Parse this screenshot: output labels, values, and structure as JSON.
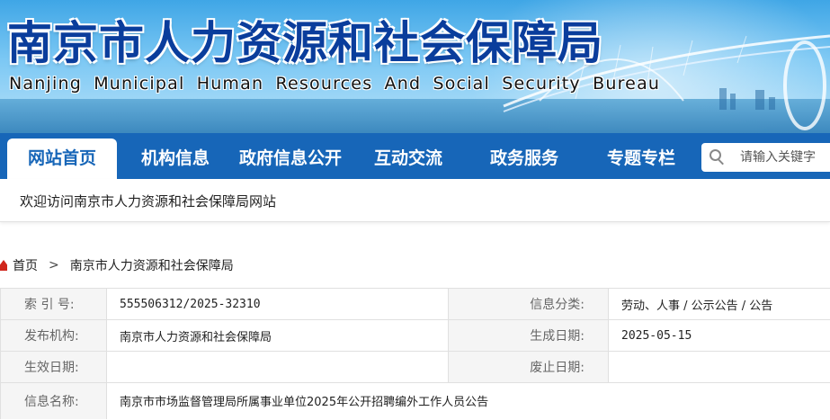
{
  "header": {
    "title_cn": "南京市人力资源和社会保障局",
    "title_en": "Nanjing Municipal Human Resources And Social Security Bureau"
  },
  "nav": {
    "items": [
      {
        "label": "网站首页",
        "active": true
      },
      {
        "label": "机构信息"
      },
      {
        "label": "政府信息公开"
      },
      {
        "label": "互动交流"
      },
      {
        "label": "政务服务"
      },
      {
        "label": "专题专栏"
      }
    ],
    "search": {
      "placeholder": "请输入关键字"
    }
  },
  "welcome_text": "欢迎访问南京市人力资源和社会保障局网站",
  "breadcrumb": {
    "home": "首页",
    "current": "南京市人力资源和社会保障局"
  },
  "info": {
    "index_label": "索 引 号:",
    "index_value": "555506312/2025-32310",
    "category_label": "信息分类:",
    "category_value": "劳动、人事 / 公示公告 / 公告",
    "publisher_label": "发布机构:",
    "publisher_value": "南京市人力资源和社会保障局",
    "created_label": "生成日期:",
    "created_value": "2025-05-15",
    "effective_label": "生效日期:",
    "effective_value": "",
    "expired_label": "废止日期:",
    "expired_value": "",
    "name_label": "信息名称:",
    "name_value": "南京市市场监督管理局所属事业单位2025年公开招聘编外工作人员公告"
  },
  "colors": {
    "nav_bg": "#1766b8",
    "title_blue": "#0a3d9c",
    "home_icon": "#d0261c"
  }
}
